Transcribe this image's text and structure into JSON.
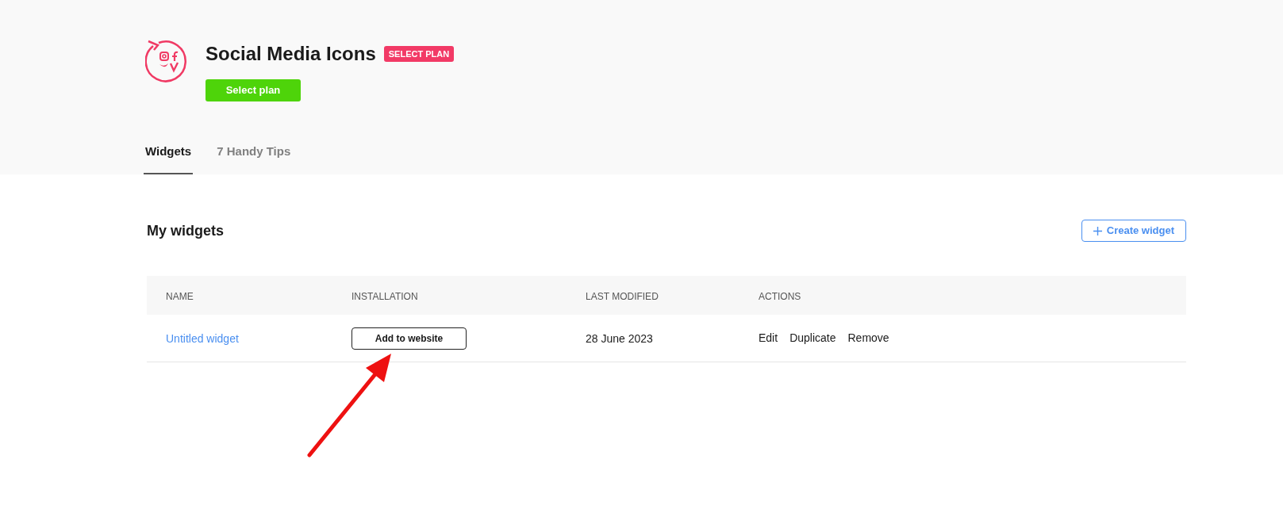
{
  "header": {
    "title": "Social Media Icons",
    "badge": "SELECT PLAN",
    "button": "Select plan"
  },
  "tabs": [
    {
      "label": "Widgets",
      "selected": true
    },
    {
      "label": "7 Handy Tips",
      "selected": false
    }
  ],
  "section": {
    "title": "My widgets",
    "create_button": "Create widget"
  },
  "table": {
    "columns": [
      "NAME",
      "INSTALLATION",
      "LAST MODIFIED",
      "ACTIONS"
    ],
    "rows": [
      {
        "name": "Untitled widget",
        "installation": "Add to website",
        "last_modified": "28 June 2023",
        "actions": [
          "Edit",
          "Duplicate",
          "Remove"
        ]
      }
    ]
  }
}
